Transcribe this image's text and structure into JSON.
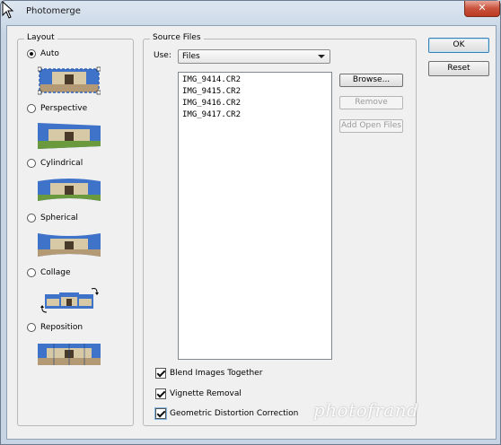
{
  "window": {
    "title": "Photomerge",
    "close_glyph": "✕"
  },
  "layout": {
    "group_label": "Layout",
    "options": [
      {
        "label": "Auto",
        "selected": true
      },
      {
        "label": "Perspective",
        "selected": false
      },
      {
        "label": "Cylindrical",
        "selected": false
      },
      {
        "label": "Spherical",
        "selected": false
      },
      {
        "label": "Collage",
        "selected": false
      },
      {
        "label": "Reposition",
        "selected": false
      }
    ]
  },
  "source": {
    "group_label": "Source Files",
    "use_label": "Use:",
    "use_value": "Files",
    "files": [
      "IMG_9414.CR2",
      "IMG_9415.CR2",
      "IMG_9416.CR2",
      "IMG_9417.CR2"
    ],
    "browse_label": "Browse...",
    "remove_label": "Remove",
    "add_open_label": "Add Open Files"
  },
  "options": {
    "blend_label": "Blend Images Together",
    "blend_checked": true,
    "vignette_label": "Vignette Removal",
    "vignette_checked": true,
    "distortion_label": "Geometric Distortion Correction",
    "distortion_checked": true
  },
  "buttons": {
    "ok_label": "OK",
    "cancel_label": "Reset"
  },
  "watermark": "photofrand",
  "colors": {
    "sky": "#3f73c9",
    "building": "#d8c9a6",
    "lawn": "#6a9a3d",
    "close": "#c9523c"
  }
}
